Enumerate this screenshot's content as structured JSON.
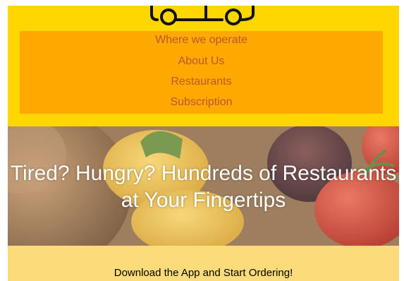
{
  "header": {
    "logo_icon": "truck-logo-icon",
    "nav": {
      "items": [
        {
          "label": "Where we operate"
        },
        {
          "label": "About Us"
        },
        {
          "label": "Restaurants"
        },
        {
          "label": "Subscription"
        }
      ]
    }
  },
  "hero": {
    "title": "Tired? Hungry? Hundreds of Restaurants at Your Fingertips"
  },
  "download": {
    "text": "Download the App and Start Ordering!"
  },
  "colors": {
    "header_bg": "#FFD600",
    "nav_bg": "#FFA800",
    "nav_text": "#C0572A",
    "download_bg": "#FCDC7A"
  }
}
